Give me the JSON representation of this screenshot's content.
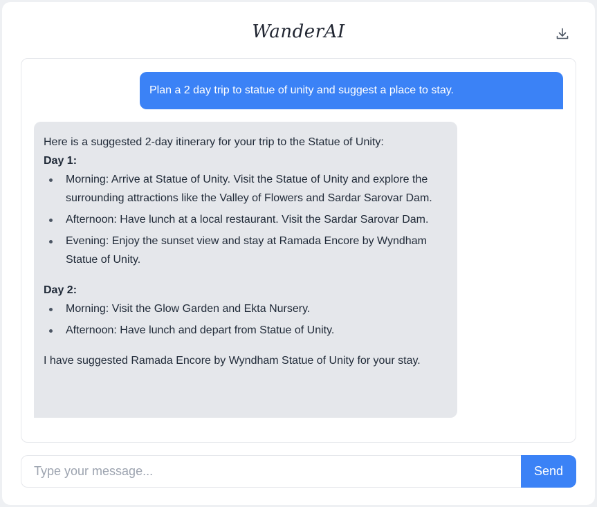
{
  "header": {
    "title": "WanderAI",
    "download_icon": "download-icon"
  },
  "chat": {
    "user_message": "Plan a 2 day trip to statue of unity and suggest a place to stay.",
    "assistant": {
      "intro": "Here is a suggested 2-day itinerary for your trip to the Statue of Unity:",
      "days": [
        {
          "heading": "Day 1:",
          "items": [
            "Morning: Arrive at Statue of Unity. Visit the Statue of Unity and explore the surrounding attractions like the Valley of Flowers and Sardar Sarovar Dam.",
            "Afternoon: Have lunch at a local restaurant. Visit the Sardar Sarovar Dam.",
            "Evening: Enjoy the sunset view and stay at Ramada Encore by Wyndham Statue of Unity."
          ]
        },
        {
          "heading": "Day 2:",
          "items": [
            "Morning: Visit the Glow Garden and Ekta Nursery.",
            "Afternoon: Have lunch and depart from Statue of Unity."
          ]
        }
      ],
      "closing": "I have suggested Ramada Encore by Wyndham Statue of Unity for your stay."
    }
  },
  "composer": {
    "placeholder": "Type your message...",
    "value": "",
    "send_label": "Send"
  },
  "colors": {
    "accent": "#3b82f6",
    "assistant_bubble": "#e5e7eb"
  }
}
